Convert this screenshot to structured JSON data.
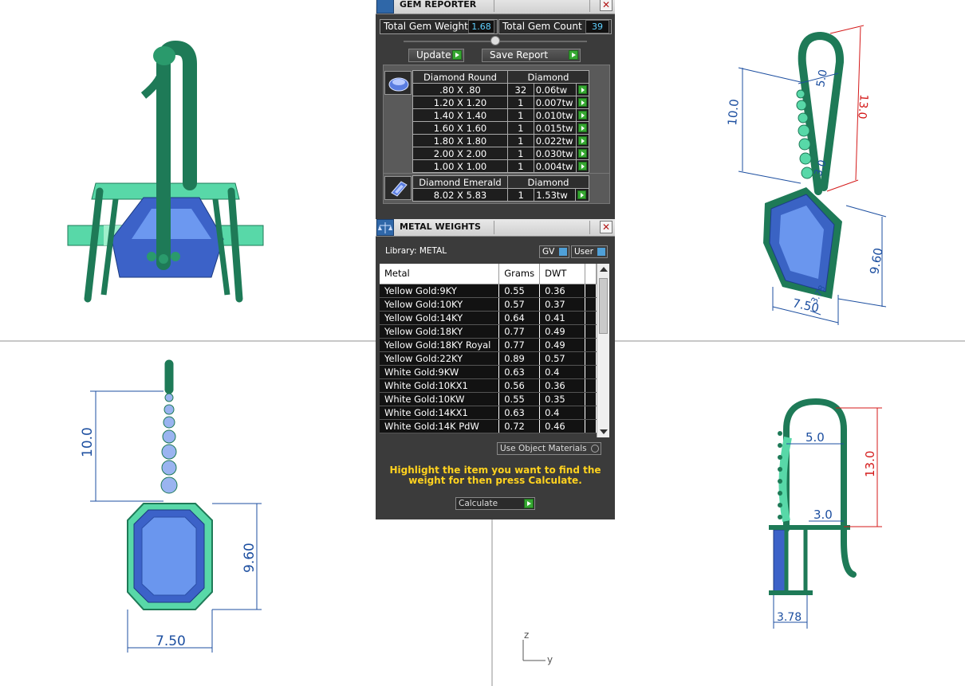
{
  "gem_reporter": {
    "title": "GEM REPORTER",
    "total_weight_label": "Total Gem Weight",
    "total_weight_value": "1.68",
    "total_count_label": "Total Gem Count",
    "total_count_value": "39",
    "update_label": "Update",
    "save_report_label": "Save Report",
    "groups": [
      {
        "shape": "Diamond Round",
        "material": "Diamond",
        "rows": [
          {
            "size": ".80 X .80",
            "count": "32",
            "weight": "0.06tw"
          },
          {
            "size": "1.20 X 1.20",
            "count": "1",
            "weight": "0.007tw"
          },
          {
            "size": "1.40 X 1.40",
            "count": "1",
            "weight": "0.010tw"
          },
          {
            "size": "1.60 X 1.60",
            "count": "1",
            "weight": "0.015tw"
          },
          {
            "size": "1.80 X 1.80",
            "count": "1",
            "weight": "0.022tw"
          },
          {
            "size": "2.00 X 2.00",
            "count": "1",
            "weight": "0.030tw"
          },
          {
            "size": "1.00 X 1.00",
            "count": "1",
            "weight": "0.004tw"
          }
        ]
      },
      {
        "shape": "Diamond Emerald",
        "material": "Diamond",
        "rows": [
          {
            "size": "8.02 X 5.83",
            "count": "1",
            "weight": "1.53tw"
          }
        ]
      }
    ]
  },
  "metal_weights": {
    "title": "METAL WEIGHTS",
    "library_label": "Library: METAL",
    "gv_label": "GV",
    "user_label": "User",
    "columns": [
      "Metal",
      "Grams",
      "DWT"
    ],
    "rows": [
      {
        "metal": "Yellow Gold:9KY",
        "grams": "0.55",
        "dwt": "0.36"
      },
      {
        "metal": "Yellow Gold:10KY",
        "grams": "0.57",
        "dwt": "0.37"
      },
      {
        "metal": "Yellow Gold:14KY",
        "grams": "0.64",
        "dwt": "0.41"
      },
      {
        "metal": "Yellow Gold:18KY",
        "grams": "0.77",
        "dwt": "0.49"
      },
      {
        "metal": "Yellow Gold:18KY Royal",
        "grams": "0.77",
        "dwt": "0.49"
      },
      {
        "metal": "Yellow Gold:22KY",
        "grams": "0.89",
        "dwt": "0.57"
      },
      {
        "metal": "White Gold:9KW",
        "grams": "0.63",
        "dwt": "0.4"
      },
      {
        "metal": "White Gold:10KX1",
        "grams": "0.56",
        "dwt": "0.36"
      },
      {
        "metal": "White Gold:10KW",
        "grams": "0.55",
        "dwt": "0.35"
      },
      {
        "metal": "White Gold:14KX1",
        "grams": "0.63",
        "dwt": "0.4"
      },
      {
        "metal": "White Gold:14K PdW",
        "grams": "0.72",
        "dwt": "0.46"
      }
    ],
    "use_object_materials_label": "Use Object Materials",
    "hint": "Highlight the item you want to find the weight for then press Calculate.",
    "calculate_label": "Calculate"
  },
  "viewports": {
    "right_dims": {
      "top": "10.0",
      "slant": "5.0",
      "hook": "13.0",
      "inner": "3.0",
      "height": "9.60",
      "width": "7.50",
      "depth": "3.78"
    },
    "front_dims": {
      "top": "10.0",
      "height": "9.60",
      "width": "7.50"
    },
    "side_dims": {
      "top": "5.0",
      "hook": "13.0",
      "inner": "3.0",
      "depth": "3.78"
    },
    "axis": {
      "z": "z",
      "y": "y"
    }
  },
  "colors": {
    "metal": "#1e7a57",
    "metal_light": "#58d8a8",
    "stone": "#4a78d8",
    "dim_blue": "#1d4fa0",
    "dim_red": "#d41a1a"
  }
}
